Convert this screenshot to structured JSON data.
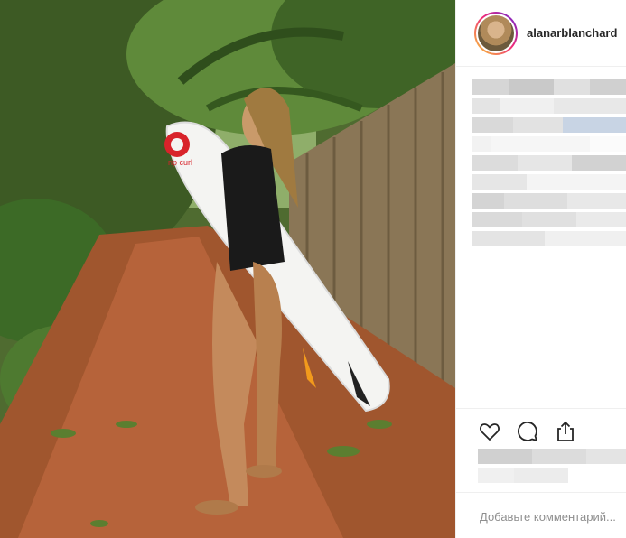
{
  "post": {
    "username": "alanarblanchard",
    "image_alt": "Woman holding a surfboard on a dirt jungle path",
    "board_brand": "rip curl"
  },
  "icons": {
    "like": "heart-icon",
    "comment": "comment-icon",
    "share": "share-icon"
  },
  "comment": {
    "placeholder": "Добавьте комментарий..."
  },
  "colors": {
    "username": "#262626",
    "border": "#efefef",
    "placeholder": "#8e8e8e"
  }
}
